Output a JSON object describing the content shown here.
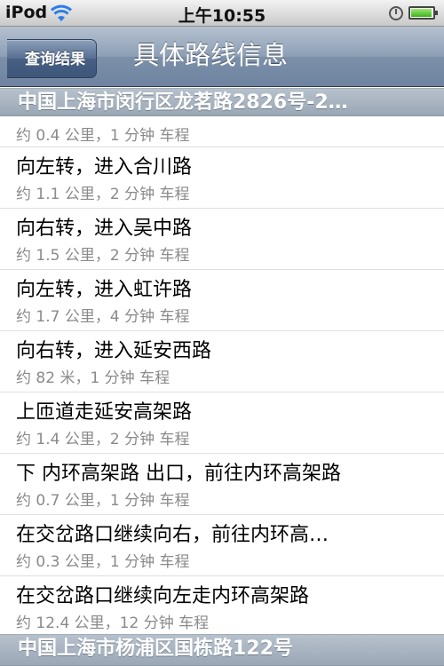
{
  "status_bar": {
    "carrier": "iPod",
    "time": "上午10:55",
    "wifi_icon": "wifi-icon",
    "lock_icon": "orientation-lock-icon",
    "battery_icon": "battery-icon"
  },
  "nav": {
    "back_label": "查询结果",
    "title": "具体路线信息"
  },
  "start_address": "中国上海市闵行区龙茗路2826号-2…",
  "first_detail": "约 0.4 公里，1 分钟 车程",
  "steps": [
    {
      "instruction": "向左转，进入合川路",
      "detail": "约 1.1 公里，2 分钟 车程"
    },
    {
      "instruction": "向右转，进入吴中路",
      "detail": "约 1.5 公里，2 分钟 车程"
    },
    {
      "instruction": "向左转，进入虹许路",
      "detail": "约 1.7 公里，4 分钟 车程"
    },
    {
      "instruction": "向右转，进入延安西路",
      "detail": "约 82 米，1 分钟 车程"
    },
    {
      "instruction": "上匝道走延安高架路",
      "detail": "约 1.4 公里，2 分钟 车程"
    },
    {
      "instruction": "下 内环高架路 出口，前往内环高架路",
      "detail": "约 0.7 公里，1 分钟 车程"
    },
    {
      "instruction": "在交岔路口继续向右，前往内环高…",
      "detail": "约 0.3 公里，1 分钟 车程"
    },
    {
      "instruction": "在交岔路口继续向左走内环高架路",
      "detail": "约 12.4 公里，12 分钟 车程"
    }
  ],
  "end_address": "中国上海市杨浦区国栋路122号"
}
